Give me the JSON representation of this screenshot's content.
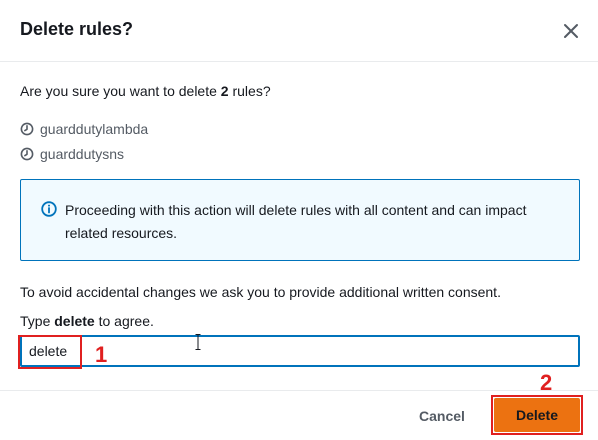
{
  "modal": {
    "title": "Delete rules?",
    "close_icon": "close-icon"
  },
  "question": {
    "prefix": "Are you sure you want to delete ",
    "count": "2",
    "suffix": " rules?"
  },
  "rules": [
    {
      "name": "guarddutylambda",
      "icon": "clock-icon"
    },
    {
      "name": "guarddutysns",
      "icon": "clock-icon"
    }
  ],
  "alert": {
    "icon": "info-icon",
    "text": "Proceeding with this action will delete rules with all content and can impact related resources."
  },
  "consent": {
    "text": "To avoid accidental changes we ask you to provide additional written consent.",
    "type_prefix": "Type ",
    "type_keyword": "delete",
    "type_suffix": " to agree.",
    "input_value": "delete"
  },
  "annotations": {
    "step1": "1",
    "step2": "2"
  },
  "footer": {
    "cancel_label": "Cancel",
    "delete_label": "Delete"
  },
  "colors": {
    "primary_button": "#ec7211",
    "alert_border": "#0073bb",
    "alert_background": "#f1faff",
    "annotation": "#e02020"
  }
}
